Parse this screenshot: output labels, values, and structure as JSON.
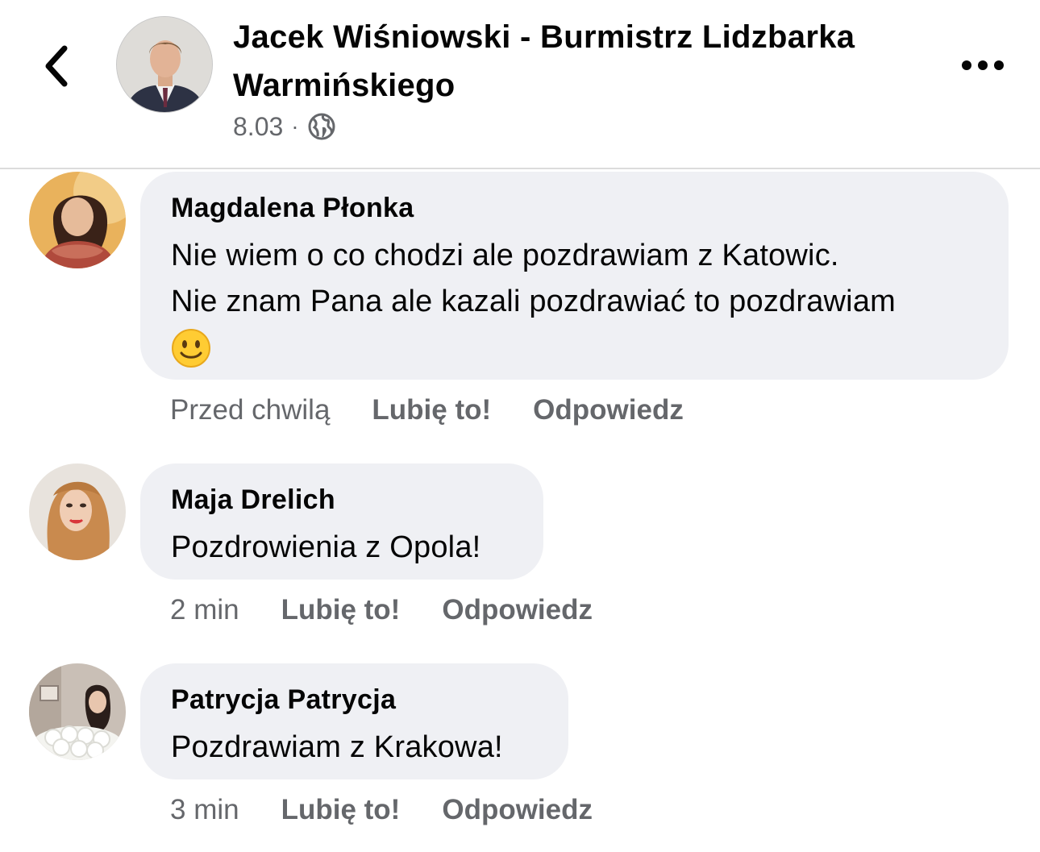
{
  "header": {
    "back_icon": "chevron-left-icon",
    "page_name": "Jacek Wiśniowski - Burmistrz Lidzbarka Warmińskiego",
    "post_date": "8.03",
    "separator": "·",
    "audience_icon": "globe-icon",
    "more_icon": "more-horizontal-icon"
  },
  "comments": [
    {
      "author": "Magdalena Płonka",
      "text_line1": "Nie wiem o co chodzi ale pozdrawiam z Katowic.",
      "text_line2": "Nie znam Pana ale kazali pozdrawiać to pozdrawiam",
      "emoji": "slightly-smiling-face-icon",
      "time": "Przed chwilą",
      "like_label": "Lubię to!",
      "reply_label": "Odpowiedz"
    },
    {
      "author": "Maja Drelich",
      "text": "Pozdrowienia z Opola!",
      "time": "2 min",
      "like_label": "Lubię to!",
      "reply_label": "Odpowiedz"
    },
    {
      "author": "Patrycja Patrycja",
      "text": "Pozdrawiam z Krakowa!",
      "time": "3 min",
      "like_label": "Lubię to!",
      "reply_label": "Odpowiedz"
    }
  ],
  "colors": {
    "bubble": "#eff0f4",
    "secondary_text": "#65676b",
    "primary_text": "#050505"
  }
}
